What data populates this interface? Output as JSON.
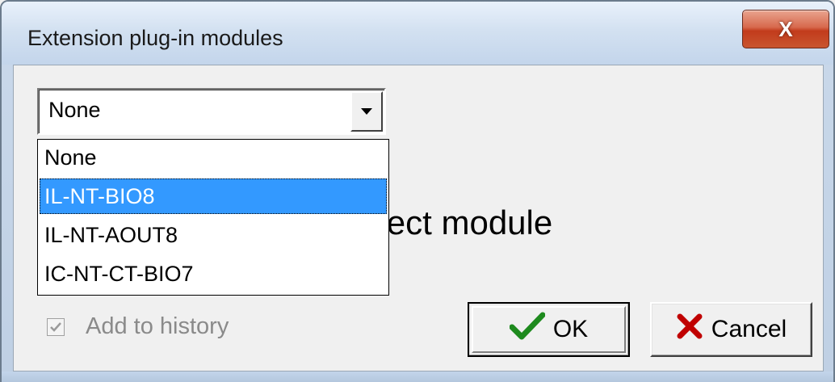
{
  "window": {
    "title": "Extension plug-in modules",
    "close_glyph": "X"
  },
  "combo": {
    "selected": "None",
    "arrow_icon": "chevron-down-icon"
  },
  "dropdown": {
    "items": [
      {
        "label": "None",
        "highlighted": false
      },
      {
        "label": "IL-NT-BIO8",
        "highlighted": true
      },
      {
        "label": "IL-NT-AOUT8",
        "highlighted": false
      },
      {
        "label": "IC-NT-CT-BIO7",
        "highlighted": false
      }
    ]
  },
  "placeholder_text": "Please select module",
  "checkbox": {
    "label": "Add to history",
    "checked": true,
    "enabled": false
  },
  "buttons": {
    "ok": {
      "label": "OK",
      "icon": "checkmark-icon",
      "icon_color": "#1e8a1e"
    },
    "cancel": {
      "label": "Cancel",
      "icon": "cross-icon",
      "icon_color": "#c00000"
    }
  },
  "colors": {
    "selection": "#3399ff",
    "close_button": "#c23b1c"
  }
}
